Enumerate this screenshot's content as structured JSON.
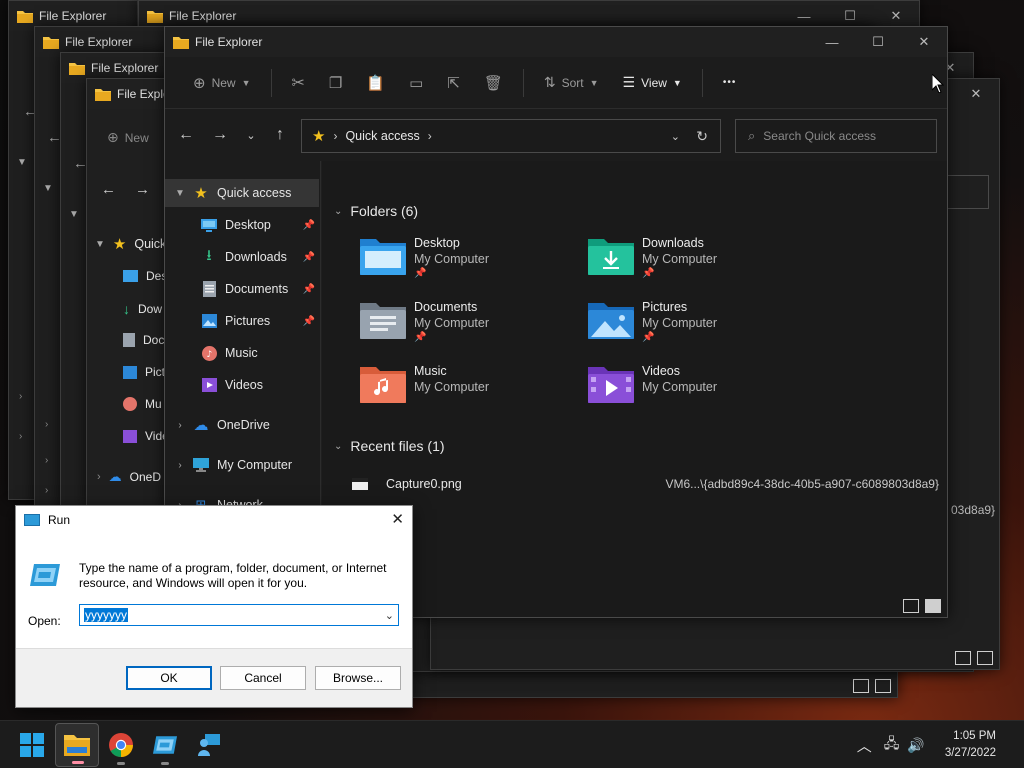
{
  "app_title": "File Explorer",
  "background_windows": [
    {
      "title": "File Explorer"
    },
    {
      "title": "File Explorer"
    },
    {
      "title": "File Explorer"
    },
    {
      "title": "File Explorer"
    },
    {
      "title": "File Explorer"
    },
    {
      "title": "File Explore"
    }
  ],
  "back_partial": {
    "new_label": "New",
    "quick_label": "Quick",
    "desk_label": "Desk",
    "down_label": "Dow",
    "docu_label": "Doc",
    "pict_label": "Pict",
    "musi_label": "Mu",
    "vide_label": "Vide",
    "onedrive_label": "OneD",
    "guid_tail_1": "03d8a9}",
    "guid_tail_2": "03"
  },
  "toolbar": {
    "new_label": "New",
    "sort_label": "Sort",
    "view_label": "View",
    "more_label": "•••"
  },
  "nav": {
    "address_location": "Quick access",
    "search_placeholder": "Search Quick access"
  },
  "sidebar": {
    "quick_access": "Quick access",
    "items": [
      {
        "label": "Desktop",
        "pinned": true
      },
      {
        "label": "Downloads",
        "pinned": true
      },
      {
        "label": "Documents",
        "pinned": true
      },
      {
        "label": "Pictures",
        "pinned": true
      },
      {
        "label": "Music",
        "pinned": false
      },
      {
        "label": "Videos",
        "pinned": false
      }
    ],
    "onedrive": "OneDrive",
    "my_computer": "My Computer",
    "network": "Network"
  },
  "folders_section": {
    "heading": "Folders (6)",
    "folders": [
      {
        "name": "Desktop",
        "location": "My Computer",
        "pinned": true
      },
      {
        "name": "Downloads",
        "location": "My Computer",
        "pinned": true
      },
      {
        "name": "Documents",
        "location": "My Computer",
        "pinned": true
      },
      {
        "name": "Pictures",
        "location": "My Computer",
        "pinned": true
      },
      {
        "name": "Music",
        "location": "My Computer",
        "pinned": false
      },
      {
        "name": "Videos",
        "location": "My Computer",
        "pinned": false
      }
    ]
  },
  "recent_section": {
    "heading": "Recent files (1)",
    "files": [
      {
        "name": "Capture0.png",
        "path": "VM6...\\{adbd89c4-38dc-40b5-a907-c6089803d8a9}"
      }
    ]
  },
  "run_dialog": {
    "title": "Run",
    "description": "Type the name of a program, folder, document, or Internet resource, and Windows will open it for you.",
    "open_label": "Open:",
    "open_value": "yyyyyyy",
    "ok_label": "OK",
    "cancel_label": "Cancel",
    "browse_label": "Browse..."
  },
  "taskbar": {
    "time": "1:05 PM",
    "date": "3/27/2022"
  },
  "colors": {
    "folder_yellow": "#f5c342",
    "star_yellow": "#f2c01e",
    "accent_blue": "#0067c0",
    "selection_blue": "#0078d7"
  },
  "icons": {
    "back": "arrow-left-icon",
    "forward": "arrow-right-icon",
    "up": "arrow-up-icon",
    "refresh": "refresh-icon",
    "search": "search-icon"
  }
}
